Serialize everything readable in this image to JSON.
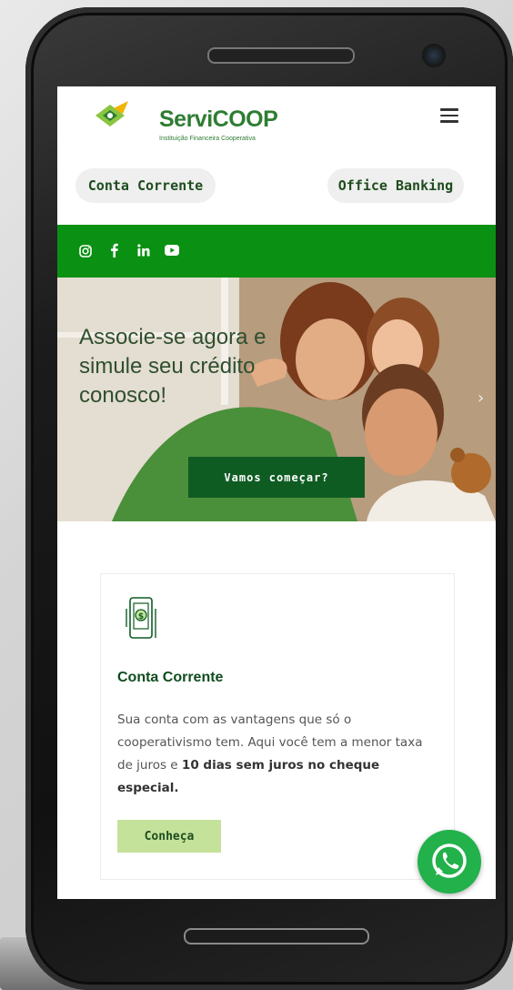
{
  "header": {
    "brand": "ServiCOOP",
    "brand_sub": "Instituição Financeira Cooperativa",
    "menu_icon": "hamburger-icon"
  },
  "quick_links": {
    "left": "Conta Corrente",
    "right": "Office Banking"
  },
  "social": [
    "instagram-icon",
    "facebook-icon",
    "linkedin-icon",
    "youtube-icon"
  ],
  "hero": {
    "headline": "Associe-se agora e simule seu crédito conosco!",
    "cta": "Vamos começar?"
  },
  "card": {
    "icon": "mobile-money-icon",
    "title": "Conta Corrente",
    "text_plain": "Sua conta com as vantagens que só o cooperativismo tem. Aqui você tem a menor taxa de juros e ",
    "text_bold": "10 dias sem juros no cheque especial.",
    "button": "Conheça"
  },
  "colors": {
    "green_bar": "#0a9012",
    "dark_green": "#0f5c23",
    "light_green": "#c5e29b",
    "whatsapp": "#22b14a"
  }
}
